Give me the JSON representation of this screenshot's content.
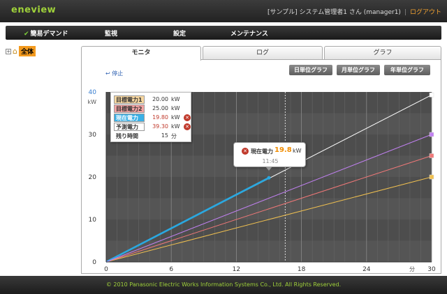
{
  "app": {
    "logo": "eneview",
    "user_text": "[サンプル]  システム管理者1 さん (manager1)",
    "logout_label": "ログアウト"
  },
  "nav": [
    {
      "label": "簡易デマンド",
      "icon": "check-icon"
    },
    {
      "label": "監視"
    },
    {
      "label": "設定"
    },
    {
      "label": "メンテナンス"
    }
  ],
  "tree": {
    "toggle": "+",
    "root_label": "全体",
    "icon": "home-icon"
  },
  "tabs": [
    {
      "label": "モニタ",
      "active": true
    },
    {
      "label": "ログ",
      "active": false
    },
    {
      "label": "グラフ",
      "active": false
    }
  ],
  "toolbar": {
    "stop_label": "停止",
    "buttons": [
      "日単位グラフ",
      "月単位グラフ",
      "年単位グラフ"
    ]
  },
  "legend": [
    {
      "label": "目標電力1",
      "value": "20.00",
      "unit": "kW",
      "color": "#f7d7a0",
      "alert": false
    },
    {
      "label": "目標電力2",
      "value": "25.00",
      "unit": "kW",
      "color": "#f3a3a3",
      "alert": false
    },
    {
      "label": "現在電力",
      "value": "19.80",
      "unit": "kW",
      "color": "#3ab0e6",
      "alert": true
    },
    {
      "label": "予測電力",
      "value": "39.30",
      "unit": "kW",
      "color": "#ffffff",
      "alert": true
    },
    {
      "label": "残り時間",
      "value": "15",
      "unit": "分",
      "color": "#ffffff",
      "alert": false
    }
  ],
  "tooltip": {
    "label": "現在電力",
    "value": "19.8",
    "unit": "kW",
    "time": "11:45"
  },
  "chart_data": {
    "type": "line",
    "y_unit": "kW",
    "x_unit": "分",
    "xlim": [
      0,
      30
    ],
    "ylim": [
      0,
      40
    ],
    "x_ticks": [
      "0",
      "6",
      "12",
      "18",
      "24",
      "30"
    ],
    "y_ticks": [
      "0",
      "10",
      "20",
      "30",
      "40"
    ],
    "current_time_minute": 16.5,
    "series": [
      {
        "name": "目標電力1",
        "color": "#f0c050",
        "x": [
          0,
          30
        ],
        "y": [
          0,
          20
        ]
      },
      {
        "name": "目標電力2",
        "color": "#f07878",
        "x": [
          0,
          30
        ],
        "y": [
          0,
          25
        ]
      },
      {
        "name": "予測電力",
        "color": "#ffffff",
        "x": [
          0,
          30
        ],
        "y": [
          0,
          39.3
        ]
      },
      {
        "name": "現在電力",
        "color": "#2aa8e0",
        "x": [
          0,
          15
        ],
        "y": [
          0,
          19.8
        ]
      },
      {
        "name": "",
        "color": "#c080f0",
        "x": [
          0,
          30
        ],
        "y": [
          0,
          30
        ]
      }
    ]
  },
  "footer": "© 2010 Panasonic Electric Works Information Systems Co., Ltd. All Rights Reserved."
}
